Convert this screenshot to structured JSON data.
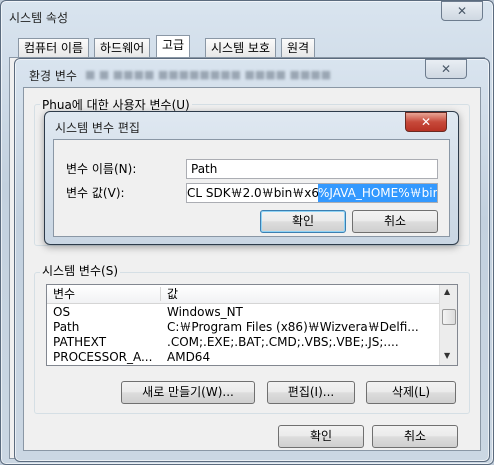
{
  "sysprops": {
    "title": "시스템 속성",
    "close_glyph": "✕",
    "tabs": [
      {
        "label": "컴퓨터 이름"
      },
      {
        "label": "하드웨어"
      },
      {
        "label": "고급"
      },
      {
        "label": "시스템 보호"
      },
      {
        "label": "원격"
      }
    ]
  },
  "envvars": {
    "title": "환경 변수",
    "close_glyph": "✕",
    "user_group_label": "Phua에 대한 사용자 변수(U)",
    "system_group_label": "시스템 변수(S)",
    "columns": {
      "name": "변수",
      "value": "값"
    },
    "rows": [
      {
        "name": "OS",
        "value": "Windows_NT"
      },
      {
        "name": "Path",
        "value": "C:￦Program Files (x86)￦Wizvera￦Delfi..."
      },
      {
        "name": "PATHEXT",
        "value": ".COM;.EXE;.BAT;.CMD;.VBS;.VBE;.JS;...."
      },
      {
        "name": "PROCESSOR_A...",
        "value": "AMD64"
      }
    ],
    "buttons": {
      "new": "새로 만들기(W)...",
      "edit": "편집(I)...",
      "delete": "삭제(L)"
    },
    "ok": "확인",
    "cancel": "취소"
  },
  "editdlg": {
    "title": "시스템 변수 편집",
    "close_glyph": "✕",
    "name_label": "변수 이름(N):",
    "value_label": "변수 값(V):",
    "name_value": "Path",
    "value_plain": "CL SDK￦2.0￦bin￦x64;",
    "value_selected": "%JAVA_HOME%￦bin",
    "ok": "확인",
    "cancel": "취소"
  }
}
